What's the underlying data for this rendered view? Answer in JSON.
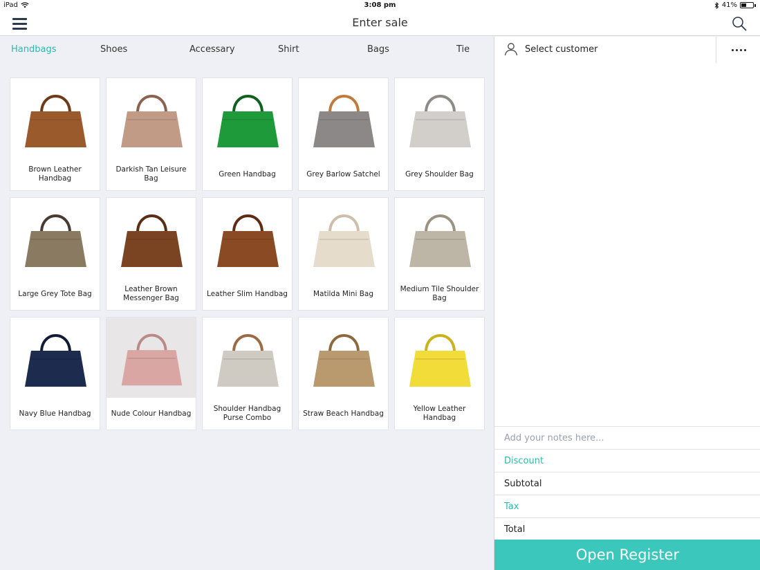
{
  "status_bar": {
    "device": "iPad",
    "time": "3:08 pm",
    "battery_text": "41%",
    "battery_level": 0.41
  },
  "nav": {
    "title": "Enter sale",
    "menu_icon": "hamburger-menu-icon",
    "search_icon": "search-icon"
  },
  "category_tabs": [
    {
      "label": "Handbags",
      "active": true
    },
    {
      "label": "Shoes",
      "active": false
    },
    {
      "label": "Accessary",
      "active": false
    },
    {
      "label": "Shirt",
      "active": false
    },
    {
      "label": "Bags",
      "active": false
    },
    {
      "label": "Tie",
      "active": false
    }
  ],
  "products": [
    {
      "name": "Brown Leather Handbag",
      "color": "#9b5a2c",
      "handle": "#6e3a18"
    },
    {
      "name": "Darkish Tan Leisure Bag",
      "color": "#c29b86",
      "handle": "#8a6450"
    },
    {
      "name": "Green Handbag",
      "color": "#1f9a3a",
      "handle": "#10601f"
    },
    {
      "name": "Grey Barlow Satchel",
      "color": "#8d8888",
      "handle": "#c07a3c"
    },
    {
      "name": "Grey Shoulder Bag",
      "color": "#d2cfcb",
      "handle": "#8e8a86"
    },
    {
      "name": "Large Grey Tote Bag",
      "color": "#8b7a62",
      "handle": "#4a3a32"
    },
    {
      "name": "Leather Brown Messenger Bag",
      "color": "#7a4422",
      "handle": "#5a2e14"
    },
    {
      "name": "Leather Slim Handbag",
      "color": "#8a4a24",
      "handle": "#5e2c12"
    },
    {
      "name": "Matilda Mini Bag",
      "color": "#e6dccb",
      "handle": "#cdbfa9"
    },
    {
      "name": "Medium Tile Shoulder Bag",
      "color": "#bdb6a6",
      "handle": "#9a9384"
    },
    {
      "name": "Navy Blue Handbag",
      "color": "#1d2b4f",
      "handle": "#131c36"
    },
    {
      "name": "Nude Colour Handbag",
      "color": "#d9a6a3",
      "handle": "#b98a87"
    },
    {
      "name": "Shoulder Handbag Purse Combo",
      "color": "#cfcac2",
      "handle": "#9a6b44"
    },
    {
      "name": "Straw Beach Handbag",
      "color": "#b99a6e",
      "handle": "#8d6a3e"
    },
    {
      "name": "Yellow Leather Handbag",
      "color": "#f2dc3a",
      "handle": "#c9b21c"
    }
  ],
  "cart": {
    "select_customer": "Select customer",
    "person_icon": "person-icon",
    "more_icon": "more-options-icon",
    "notes_placeholder": "Add your notes here...",
    "discount": "Discount",
    "subtotal": "Subtotal",
    "tax": "Tax",
    "total": "Total",
    "open_register": "Open Register"
  },
  "colors": {
    "accent": "#2cb8ad",
    "register_button": "#3cc7bc",
    "background": "#eef0f5"
  }
}
